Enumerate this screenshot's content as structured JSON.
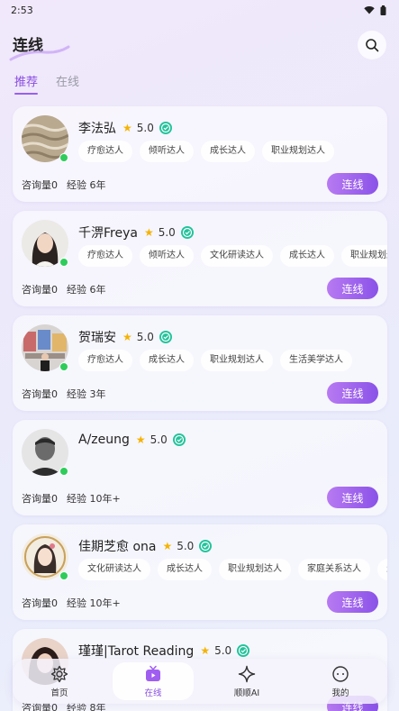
{
  "status_bar": {
    "time": "2:53"
  },
  "header": {
    "title": "连线"
  },
  "tabs": [
    {
      "label": "推荐",
      "active": true
    },
    {
      "label": "在线",
      "active": false
    }
  ],
  "advisors": [
    {
      "name": "李法弘",
      "rating": "5.0",
      "tags": [
        "疗愈达人",
        "倾听达人",
        "成长达人",
        "职业规划达人"
      ],
      "consult_count": "咨询量0",
      "experience": "经验 6年",
      "button": "连线",
      "online": true
    },
    {
      "name": "千淠Freya",
      "rating": "5.0",
      "tags": [
        "疗愈达人",
        "倾听达人",
        "文化研读达人",
        "成长达人",
        "职业规划达"
      ],
      "consult_count": "咨询量0",
      "experience": "经验 6年",
      "button": "连线",
      "online": true
    },
    {
      "name": "贺瑞安",
      "rating": "5.0",
      "tags": [
        "疗愈达人",
        "成长达人",
        "职业规划达人",
        "生活美学达人"
      ],
      "consult_count": "咨询量0",
      "experience": "经验 3年",
      "button": "连线",
      "online": true
    },
    {
      "name": "A/zeung",
      "rating": "5.0",
      "tags": [],
      "consult_count": "咨询量0",
      "experience": "经验 10年+",
      "button": "连线",
      "online": true
    },
    {
      "name": "佳期芝愈 ona",
      "rating": "5.0",
      "tags": [
        "文化研读达人",
        "成长达人",
        "职业规划达人",
        "家庭关系达人",
        "生"
      ],
      "consult_count": "咨询量0",
      "experience": "经验 10年+",
      "button": "连线",
      "online": true
    },
    {
      "name": "瑾瑾|Tarot Reading",
      "rating": "5.0",
      "tags": [],
      "consult_count": "咨询量0",
      "experience": "经验 8年",
      "button": "连线",
      "online": false
    }
  ],
  "bottom_nav": [
    {
      "label": "首页",
      "icon": "home-flower-icon",
      "active": false
    },
    {
      "label": "在线",
      "icon": "tv-icon",
      "active": true
    },
    {
      "label": "顺顺AI",
      "icon": "sparkle-icon",
      "active": false
    },
    {
      "label": "我的",
      "icon": "profile-face-icon",
      "active": false
    }
  ],
  "colors": {
    "accent": "#8a4fe0",
    "online": "#2ecc5b",
    "star": "#f5b301",
    "certified": "#22c39a"
  }
}
